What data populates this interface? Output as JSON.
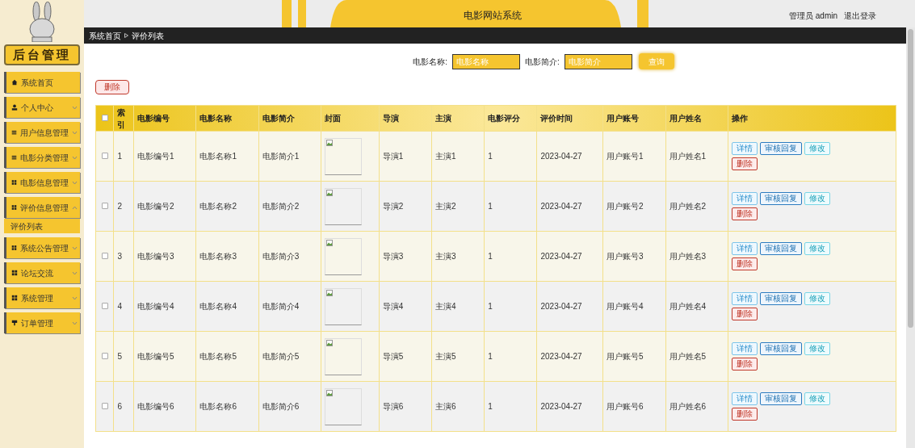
{
  "sidebar": {
    "title": "后台管理",
    "items": [
      {
        "label": "系统首页"
      },
      {
        "label": "个人中心",
        "expanded": false
      },
      {
        "label": "用户信息管理",
        "expanded": false
      },
      {
        "label": "电影分类管理",
        "expanded": false
      },
      {
        "label": "电影信息管理",
        "expanded": false
      },
      {
        "label": "评价信息管理",
        "expanded": true,
        "children": [
          {
            "label": "评价列表",
            "selected": true
          }
        ]
      },
      {
        "label": "系统公告管理",
        "expanded": false
      },
      {
        "label": "论坛交流",
        "expanded": false
      },
      {
        "label": "系统管理",
        "expanded": false
      },
      {
        "label": "订单管理",
        "expanded": false
      }
    ]
  },
  "header": {
    "title": "电影网站系统",
    "user": "管理员 admin",
    "logout": "退出登录"
  },
  "breadcrumb": [
    "系统首页",
    "评价列表"
  ],
  "search": {
    "fields": [
      {
        "label": "电影名称:",
        "placeholder": "电影名称"
      },
      {
        "label": "电影简介:",
        "placeholder": "电影简介"
      }
    ],
    "button": "查询"
  },
  "delete_button": "删除",
  "table": {
    "all_checked": false,
    "columns": [
      "索引",
      "电影编号",
      "电影名称",
      "电影简介",
      "封面",
      "导演",
      "主演",
      "电影评分",
      "评价时间",
      "用户账号",
      "用户姓名",
      "操作"
    ],
    "rows": [
      {
        "checked": false,
        "cells": [
          "1",
          "电影编号1",
          "电影名称1",
          "电影简介1",
          "",
          "导演1",
          "主演1",
          "1",
          "2023-04-27",
          "用户账号1",
          "用户姓名1"
        ],
        "actions": [
          "详情",
          "审核回复",
          "修改",
          "删除"
        ]
      },
      {
        "checked": false,
        "cells": [
          "2",
          "电影编号2",
          "电影名称2",
          "电影简介2",
          "",
          "导演2",
          "主演2",
          "1",
          "2023-04-27",
          "用户账号2",
          "用户姓名2"
        ],
        "actions": [
          "详情",
          "审核回复",
          "修改",
          "删除"
        ]
      },
      {
        "checked": false,
        "cells": [
          "3",
          "电影编号3",
          "电影名称3",
          "电影简介3",
          "",
          "导演3",
          "主演3",
          "1",
          "2023-04-27",
          "用户账号3",
          "用户姓名3"
        ],
        "actions": [
          "详情",
          "审核回复",
          "修改",
          "删除"
        ]
      },
      {
        "checked": false,
        "cells": [
          "4",
          "电影编号4",
          "电影名称4",
          "电影简介4",
          "",
          "导演4",
          "主演4",
          "1",
          "2023-04-27",
          "用户账号4",
          "用户姓名4"
        ],
        "actions": [
          "详情",
          "审核回复",
          "修改",
          "删除"
        ]
      },
      {
        "checked": false,
        "cells": [
          "5",
          "电影编号5",
          "电影名称5",
          "电影简介5",
          "",
          "导演5",
          "主演5",
          "1",
          "2023-04-27",
          "用户账号5",
          "用户姓名5"
        ],
        "actions": [
          "详情",
          "审核回复",
          "修改",
          "删除"
        ]
      },
      {
        "checked": false,
        "cells": [
          "6",
          "电影编号6",
          "电影名称6",
          "电影简介6",
          "",
          "导演6",
          "主演6",
          "1",
          "2023-04-27",
          "用户账号6",
          "用户姓名6"
        ],
        "actions": [
          "详情",
          "审核回复",
          "修改",
          "删除"
        ]
      }
    ]
  }
}
